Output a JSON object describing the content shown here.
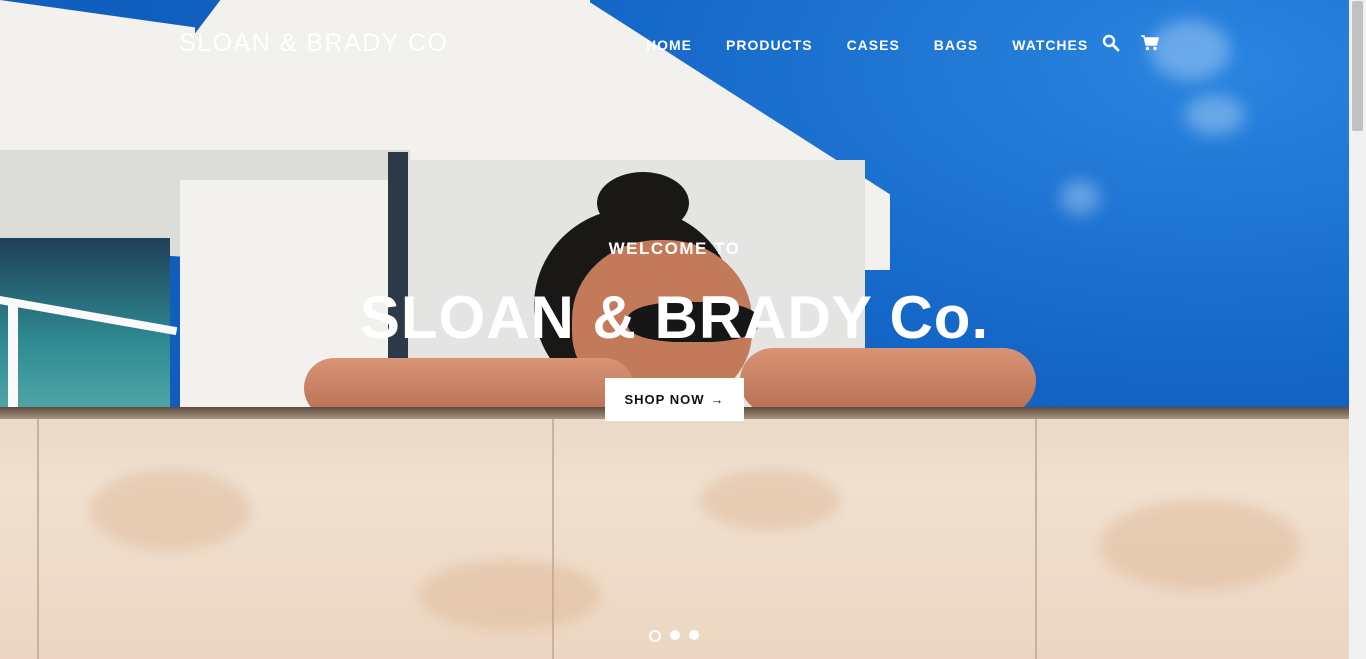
{
  "header": {
    "logo": "SLOAN & BRADY CO",
    "nav": [
      {
        "label": "HOME"
      },
      {
        "label": "PRODUCTS"
      },
      {
        "label": "CASES"
      },
      {
        "label": "BAGS"
      },
      {
        "label": "WATCHES"
      }
    ],
    "icons": [
      "search-icon",
      "cart-icon"
    ]
  },
  "hero": {
    "kicker": "WELCOME TO",
    "title": "SLOAN & BRADY Co.",
    "cta_label": "SHOP NOW",
    "cta_arrow": "→",
    "slides_count": 3,
    "active_slide": 1
  },
  "colors": {
    "sky": "#1263c4",
    "text": "#ffffff",
    "button_bg": "#ffffff",
    "button_text": "#111111"
  }
}
